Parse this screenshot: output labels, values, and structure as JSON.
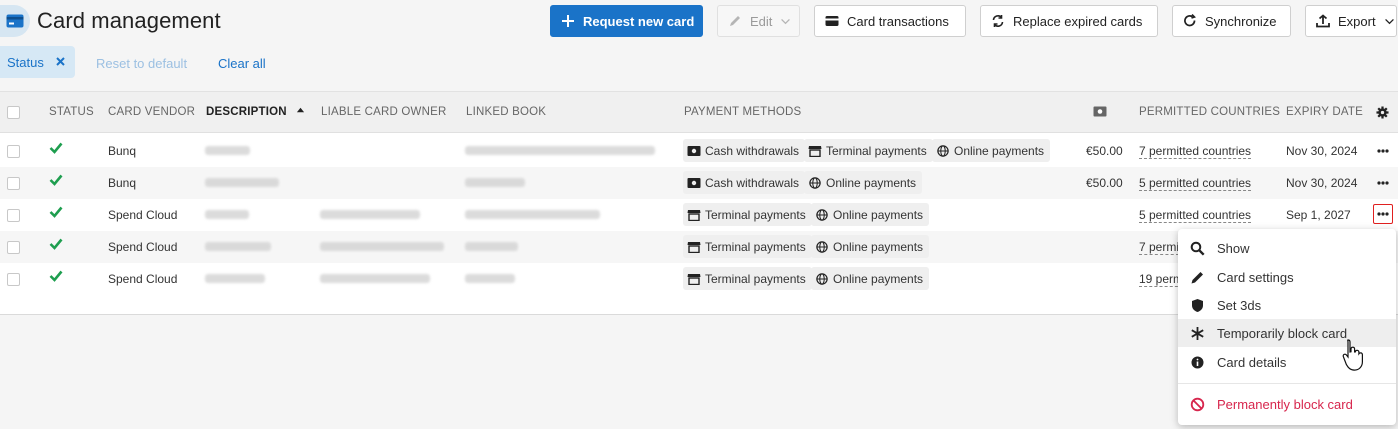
{
  "header": {
    "title": "Card management",
    "buttons": {
      "request_new_card": "Request new card",
      "edit": "Edit",
      "card_transactions": "Card transactions",
      "replace_expired": "Replace expired cards",
      "synchronize": "Synchronize",
      "export": "Export"
    }
  },
  "filters": {
    "chip_label": "Status",
    "reset": "Reset to default",
    "clear_all": "Clear all"
  },
  "table": {
    "columns": [
      "STATUS",
      "CARD VENDOR",
      "DESCRIPTION",
      "LIABLE CARD OWNER",
      "LINKED BOOK",
      "PAYMENT METHODS",
      "PERMITTED COUNTRIES",
      "EXPIRY DATE"
    ],
    "rows": [
      {
        "vendor": "Bunq",
        "payment_methods": [
          "Cash withdrawals",
          "Terminal payments",
          "Online payments"
        ],
        "amount": "€50.00",
        "countries": "7 permitted countries",
        "expiry": "Nov 30, 2024"
      },
      {
        "vendor": "Bunq",
        "payment_methods": [
          "Cash withdrawals",
          "Online payments"
        ],
        "amount": "€50.00",
        "countries": "5 permitted countries",
        "expiry": "Nov 30, 2024"
      },
      {
        "vendor": "Spend Cloud",
        "payment_methods": [
          "Terminal payments",
          "Online payments"
        ],
        "amount": "",
        "countries": "5 permitted countries",
        "expiry": "Sep 1, 2027"
      },
      {
        "vendor": "Spend Cloud",
        "payment_methods": [
          "Terminal payments",
          "Online payments"
        ],
        "amount": "",
        "countries": "7 permi",
        "expiry": ""
      },
      {
        "vendor": "Spend Cloud",
        "payment_methods": [
          "Terminal payments",
          "Online payments"
        ],
        "amount": "",
        "countries": "19 perm",
        "expiry": ""
      }
    ]
  },
  "menu": {
    "items": [
      {
        "label": "Show",
        "icon": "search-icon"
      },
      {
        "label": "Card settings",
        "icon": "pencil-icon"
      },
      {
        "label": "Set 3ds",
        "icon": "shield-icon"
      },
      {
        "label": "Temporarily block card",
        "icon": "snowflake-icon"
      },
      {
        "label": "Card details",
        "icon": "info-icon"
      }
    ],
    "danger_item": {
      "label": "Permanently block card",
      "icon": "ban-icon"
    }
  },
  "colors": {
    "primary": "#1a73c8",
    "success": "#1e9e4f",
    "danger": "#d7264d"
  }
}
